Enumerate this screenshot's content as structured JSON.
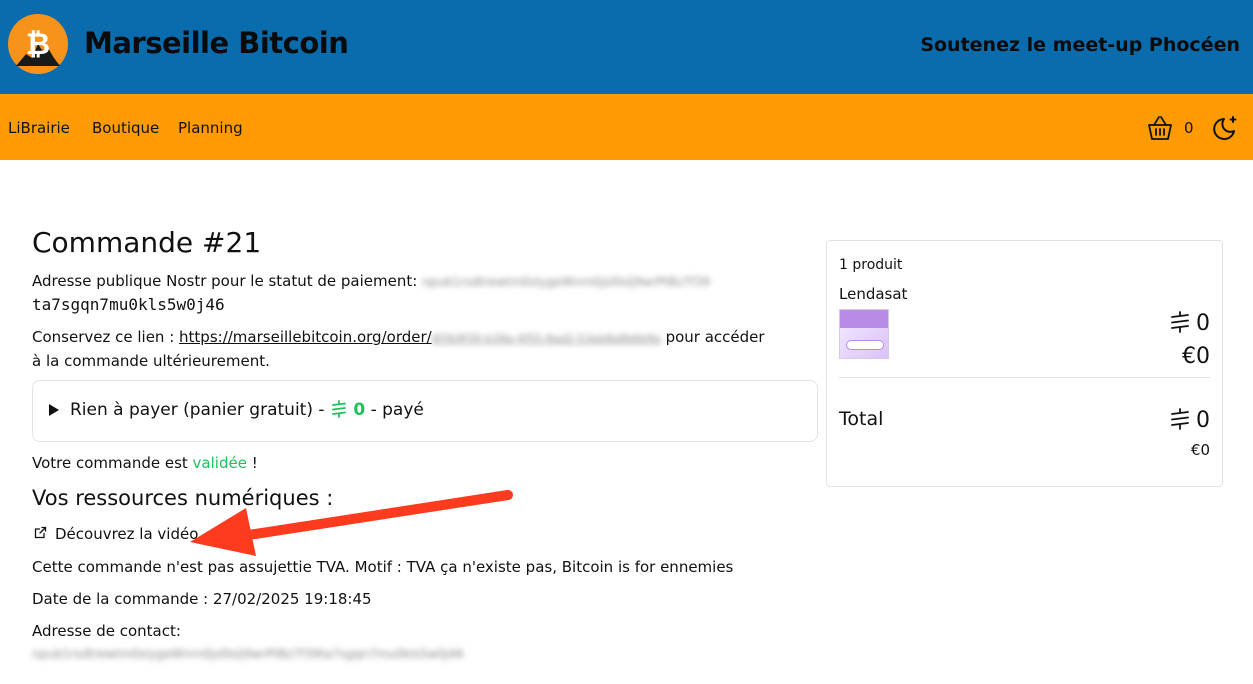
{
  "header": {
    "brand": "Marseille Bitcoin",
    "tagline": "Soutenez le meet-up Phocéen",
    "logo_icon": "bitcoin-logo-icon",
    "background_color": "#0b6cad"
  },
  "nav": {
    "background_color": "#fe9b02",
    "items": [
      {
        "label": "LiBrairie"
      },
      {
        "label": "Boutique"
      },
      {
        "label": "Planning"
      }
    ],
    "cart_icon": "basket-icon",
    "cart_count": "0",
    "theme_icon": "moon-icon"
  },
  "order": {
    "title": "Commande #21",
    "nostr_label": "Adresse publique Nostr pour le statut de paiement:",
    "nostr_value_blurred": "npub1rsdtrewtm0slygeWnrn0jsl0slj9wrPtBz7f39",
    "nostr_value_tail": "ta7sgqn7mu0kls5w0j46",
    "link_prefix": "Conservez ce lien : ",
    "link_url": "https://marseillebitcoin.org/order/",
    "link_id_blurred": "6f3b9f30-b39a-4f55-8ad2-53eb8a8b6b9a",
    "link_suffix": "pour accéder",
    "link_suffix_line2": "à la commande ultérieurement.",
    "payment_label": "Rien à payer (panier gratuit) -",
    "payment_amount": "0",
    "payment_status": "- payé",
    "validated_prefix": "Votre commande est ",
    "validated_word": "validée",
    "validated_suffix": " !",
    "resources_title": "Vos ressources numériques :",
    "video_link": "Découvrez la vidéo",
    "vat_notice": "Cette commande n'est pas assujettie TVA. Motif : TVA ça n'existe pas, Bitcoin is for ennemies",
    "date_line": "Date de la commande : 27/02/2025 19:18:45",
    "contact_label": "Adresse de contact:",
    "contact_value_blurred": "npub1rsdtrewtm0slygeWnrn0jsl0slj9wrPtBz7f39ta7sgqn7mu0kls5w0j46"
  },
  "summary": {
    "count": "1 produit",
    "product_name": "Lendasat",
    "product_sat": "0",
    "product_eur": "€0",
    "total_label": "Total",
    "total_sat": "0",
    "total_eur": "€0"
  },
  "colors": {
    "accent_green": "#22c05a",
    "arrow_red": "#ff3b1f"
  }
}
